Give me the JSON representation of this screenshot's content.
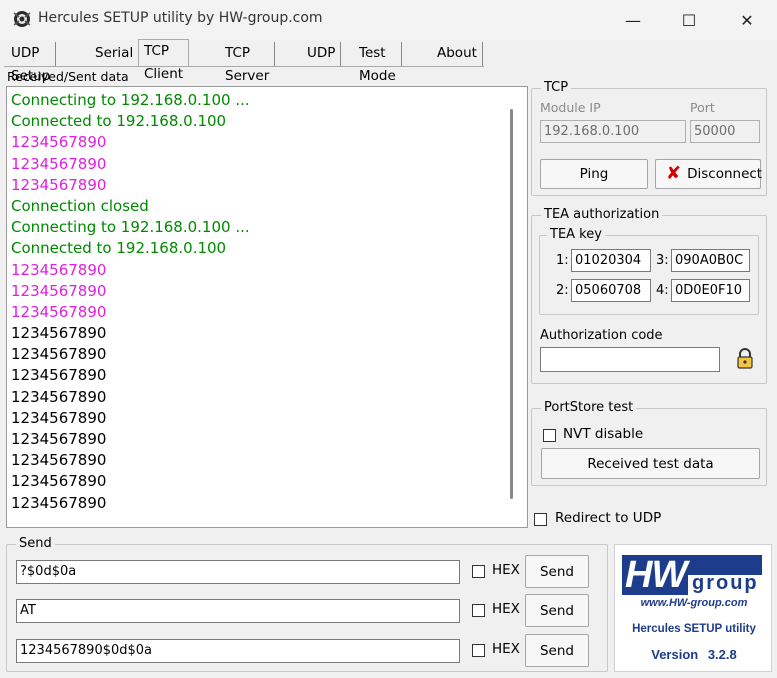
{
  "window": {
    "title": "Hercules SETUP utility by HW-group.com",
    "minimize": "—",
    "maximize": "☐",
    "close": "✕"
  },
  "tabs": [
    {
      "label": "UDP Setup"
    },
    {
      "label": "Serial"
    },
    {
      "label": "TCP Client"
    },
    {
      "label": "TCP Server"
    },
    {
      "label": "UDP"
    },
    {
      "label": "Test Mode"
    },
    {
      "label": "About"
    }
  ],
  "received": {
    "label": "Received/Sent data",
    "lines": [
      {
        "text": "Connecting to 192.168.0.100 ...",
        "color": "#008a00"
      },
      {
        "text": "Connected to 192.168.0.100",
        "color": "#008a00"
      },
      {
        "text": "1234567890",
        "color": "#e020e0"
      },
      {
        "text": "1234567890",
        "color": "#e020e0"
      },
      {
        "text": "1234567890",
        "color": "#e020e0"
      },
      {
        "text": "Connection closed",
        "color": "#008a00"
      },
      {
        "text": "Connecting to 192.168.0.100 ...",
        "color": "#008a00"
      },
      {
        "text": "Connected to 192.168.0.100",
        "color": "#008a00"
      },
      {
        "text": "1234567890",
        "color": "#e020e0"
      },
      {
        "text": "1234567890",
        "color": "#e020e0"
      },
      {
        "text": "1234567890",
        "color": "#e020e0"
      },
      {
        "text": "1234567890",
        "color": "#000000"
      },
      {
        "text": "1234567890",
        "color": "#000000"
      },
      {
        "text": "1234567890",
        "color": "#000000"
      },
      {
        "text": "1234567890",
        "color": "#000000"
      },
      {
        "text": "1234567890",
        "color": "#000000"
      },
      {
        "text": "1234567890",
        "color": "#000000"
      },
      {
        "text": "1234567890",
        "color": "#000000"
      },
      {
        "text": "1234567890",
        "color": "#000000"
      },
      {
        "text": "1234567890",
        "color": "#000000"
      }
    ]
  },
  "tcp": {
    "title": "TCP",
    "module_ip_label": "Module IP",
    "module_ip": "192.168.0.100",
    "port_label": "Port",
    "port": "50000",
    "ping_label": "Ping",
    "disconnect_label": "Disconnect"
  },
  "tea": {
    "title": "TEA authorization",
    "key_title": "TEA key",
    "keys": [
      {
        "index": "1:",
        "value": "01020304"
      },
      {
        "index": "3:",
        "value": "090A0B0C"
      },
      {
        "index": "2:",
        "value": "05060708"
      },
      {
        "index": "4:",
        "value": "0D0E0F10"
      }
    ],
    "auth_code_label": "Authorization code",
    "auth_code": ""
  },
  "portstore": {
    "title": "PortStore test",
    "nvt_label": "NVT disable",
    "received_test_label": "Received test data"
  },
  "redirect_label": "Redirect to UDP",
  "send": {
    "title": "Send",
    "rows": [
      {
        "value": "?$0d$0a",
        "hex_label": "HEX",
        "button": "Send"
      },
      {
        "value": "AT",
        "hex_label": "HEX",
        "button": "Send"
      },
      {
        "value": "1234567890$0d$0a",
        "hex_label": "HEX",
        "button": "Send"
      }
    ]
  },
  "logo": {
    "brand_left": "HW",
    "brand_right": "group",
    "url": "www.HW-group.com",
    "product": "Hercules SETUP utility",
    "version_label": "Version",
    "version": "3.2.8",
    "accent": "#1e3c8c"
  }
}
